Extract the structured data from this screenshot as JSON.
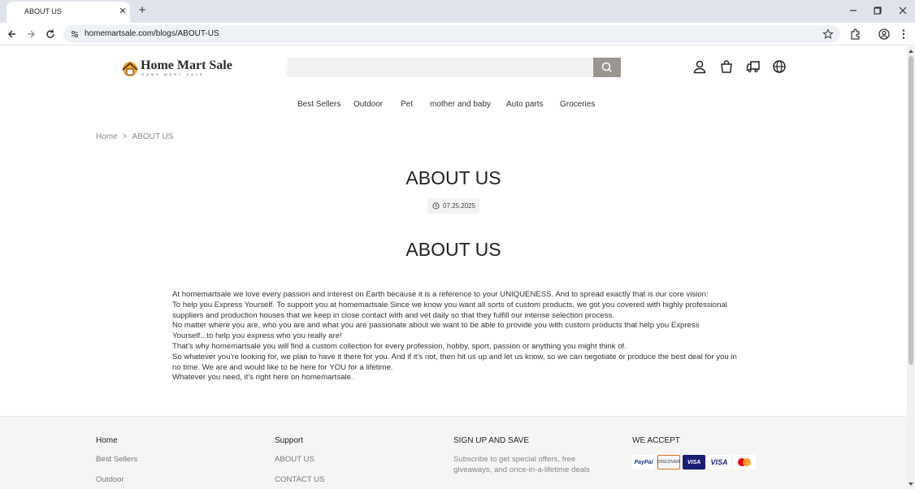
{
  "browser": {
    "tab_title": "ABOUT US",
    "url": "homemartsale.com/blogs/ABOUT-US"
  },
  "header": {
    "logo_title": "Home Mart Sale",
    "logo_subtitle": "HOME MART SALE",
    "search_placeholder": ""
  },
  "nav": {
    "items": [
      "Best Sellers",
      "Outdoor",
      "Pet",
      "mother and baby",
      "Auto parts",
      "Groceries"
    ]
  },
  "breadcrumb": {
    "home": "Home",
    "separator": ">",
    "current": "ABOUT US"
  },
  "article": {
    "title": "ABOUT US",
    "date": "07.25.2025",
    "heading": "ABOUT US",
    "paragraphs": [
      "At homemartsale we love every passion and interest on Earth because it is a reference to your UNIQUENESS. And to spread exactly that is our core vision:",
      "To help you Express Yourself. To support you at homemartsale Since we know you want all sorts of custom products, we got you covered with highly professional suppliers and production houses that we keep in close contact with and vet daily so that they fulfill our intense selection process.",
      "No matter where you are, who you are and what you are passionate about we want to be able to provide you with custom products that help you Express Yourself...to help you express who you really are!",
      "That's why homemartsale you will find a custom collection for every profession, hobby, sport, passion or anything you might think of.",
      "So whatever you're looking for, we plan to have it there for you. And if it's not, then hit us up and let us know, so we can negotiate or produce the best deal for you in no time. We are and would like to be here for YOU for a lifetime.",
      "Whatever you need, it's right here on homemartsale."
    ]
  },
  "footer": {
    "col1": {
      "heading": "Home",
      "links": [
        "Best Sellers",
        "Outdoor"
      ]
    },
    "col2": {
      "heading": "Support",
      "links": [
        "ABOUT US",
        "CONTACT US"
      ]
    },
    "col3": {
      "heading": "SIGN UP AND SAVE",
      "text": "Subscribe to get special offers, free giveaways, and once-in-a-lifetime deals"
    },
    "col4": {
      "heading": "WE ACCEPT",
      "cards": [
        "PayPal",
        "DISCOVER",
        "VISA",
        "VISA",
        "Mastercard"
      ]
    }
  },
  "colors": {
    "search_button": "#9b9590",
    "footer_bg": "#f5f5f5",
    "tabbar_bg": "#dfe3eb"
  }
}
